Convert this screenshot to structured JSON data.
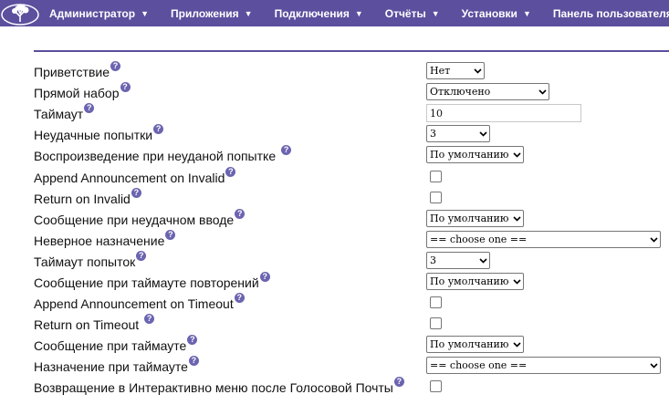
{
  "nav": {
    "items": [
      {
        "label": "Администратор"
      },
      {
        "label": "Приложения"
      },
      {
        "label": "Подключения"
      },
      {
        "label": "Отчёты"
      },
      {
        "label": "Установки"
      },
      {
        "label": "Панель пользователя"
      }
    ],
    "accent_color": "#5b4f9e"
  },
  "form": {
    "greeting": {
      "label": "Приветствие",
      "value": "Нет"
    },
    "direct_dial": {
      "label": "Прямой набор",
      "value": "Отключено"
    },
    "timeout": {
      "label": "Таймаут",
      "value": "10"
    },
    "invalid_retries": {
      "label": "Неудачные попытки",
      "value": "3"
    },
    "invalid_playback": {
      "label": "Воспроизведение при неуданой попытке",
      "value": "По умолчанию"
    },
    "append_invalid": {
      "label": "Append Announcement on Invalid",
      "checked": false
    },
    "return_invalid": {
      "label": "Return on Invalid",
      "checked": false
    },
    "invalid_message": {
      "label": "Сообщение при неудачном вводе",
      "value": "По умолчанию"
    },
    "invalid_destination": {
      "label": "Неверное назначение",
      "value": "== choose one =="
    },
    "timeout_retries": {
      "label": "Таймаут попыток",
      "value": "3"
    },
    "timeout_retry_message": {
      "label": "Сообщение при таймауте повторений",
      "value": "По умолчанию"
    },
    "append_timeout": {
      "label": "Append Announcement on Timeout",
      "checked": false
    },
    "return_timeout": {
      "label": "Return on Timeout",
      "checked": false
    },
    "timeout_message": {
      "label": "Сообщение при таймауте",
      "value": "По умолчанию"
    },
    "timeout_destination": {
      "label": "Назначение при таймауте",
      "value": "== choose one =="
    },
    "return_after_vm": {
      "label": "Возвращение в Интерактивно меню после Голосовой Почты",
      "checked": false
    }
  },
  "icons": {
    "help": "question-mark",
    "dropdown": "chevron-down",
    "logo": "tree-logo"
  }
}
